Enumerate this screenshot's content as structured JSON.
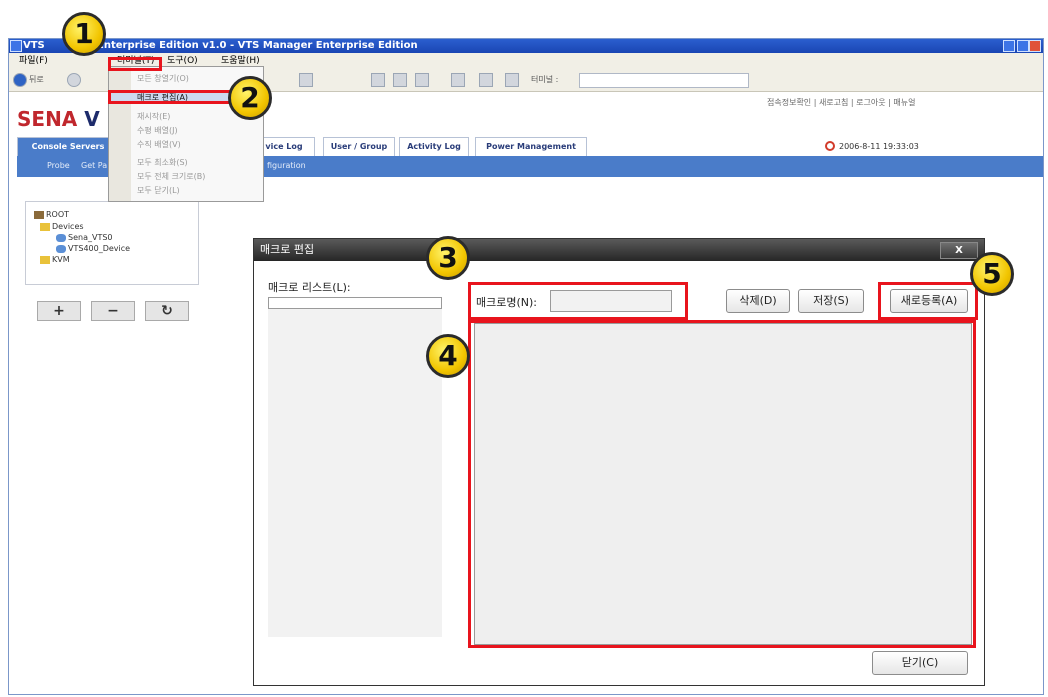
{
  "window": {
    "title": "VTS Manager Enterprise Edition v1.0 - VTS Manager Enterprise Edition",
    "title_left": "VTS",
    "title_right": "Enterprise Edition v1.0 - VTS Manager Enterprise Edition"
  },
  "menubar": {
    "file": "파일(F)",
    "terminal": "터미널(T)",
    "tools": "도구(O)",
    "help": "도움말(H)"
  },
  "toolbar": {
    "back": "뒤로",
    "terminal_label": "터미널 :"
  },
  "app": {
    "logo_red": "SENA",
    "logo_blue": "V",
    "top_links": "접속정보확인 | 새로고침 | 로그아웃 | 매뉴얼",
    "datetime": "2006-8-11 19:33:03",
    "tabs": [
      "Console Servers",
      "vice Log",
      "User / Group",
      "Activity Log",
      "Power Management"
    ],
    "sub_links": [
      "Probe",
      "Get Pa",
      "figuration"
    ]
  },
  "dropdown": {
    "items": [
      "모든 창열기(O)",
      "매크로 편집(A)",
      "재시작(E)",
      "수평 배열(J)",
      "수직 배열(V)",
      "모두 최소화(S)",
      "모두 전체 크기로(B)",
      "모두 닫기(L)"
    ]
  },
  "tree": {
    "root": "ROOT",
    "devices": "Devices",
    "device1": "Sena_VTS0",
    "device2": "VTS400_Device",
    "kvm": "KVM",
    "btn_add": "+",
    "btn_remove": "−",
    "btn_refresh": "↻"
  },
  "dialog": {
    "title": "매크로 편집",
    "close": "X",
    "list_label": "매크로 리스트(L):",
    "name_label": "매크로명(N):",
    "name_value": "",
    "delete": "삭제(D)",
    "save": "저장(S)",
    "new": "새로등록(A)",
    "close_btn": "닫기(C)"
  },
  "annotations": [
    "1",
    "2",
    "3",
    "4",
    "5"
  ],
  "colors": {
    "annotation_red": "#e8141d",
    "annotation_yellow": "#f2c500",
    "title_blue": "#1a45b3",
    "tab_blue": "#4a7cc9"
  }
}
